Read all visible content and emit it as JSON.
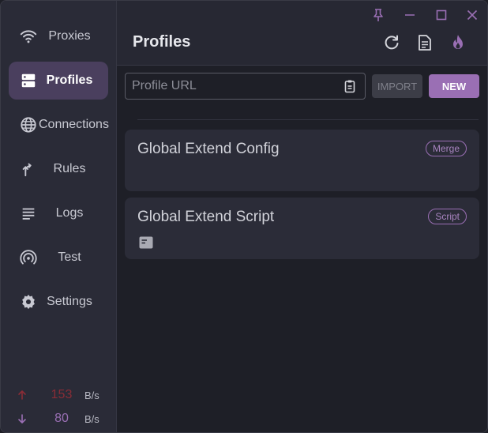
{
  "sidebar": {
    "items": [
      {
        "label": "Proxies",
        "icon": "wifi-icon",
        "active": false
      },
      {
        "label": "Profiles",
        "icon": "dns-icon",
        "active": true
      },
      {
        "label": "Connections",
        "icon": "globe-icon",
        "active": false
      },
      {
        "label": "Rules",
        "icon": "fork-icon",
        "active": false
      },
      {
        "label": "Logs",
        "icon": "list-icon",
        "active": false
      },
      {
        "label": "Test",
        "icon": "radar-icon",
        "active": false
      },
      {
        "label": "Settings",
        "icon": "gear-icon",
        "active": false
      }
    ],
    "traffic": {
      "up": {
        "value": "153",
        "unit": "B/s",
        "color": "#8a2c36"
      },
      "down": {
        "value": "80",
        "unit": "B/s",
        "color": "#9a6fb4"
      }
    }
  },
  "header": {
    "title": "Profiles",
    "buttons": [
      "refresh-icon",
      "document-icon",
      "fire-icon"
    ]
  },
  "window_controls": [
    "pin-icon",
    "minimize-icon",
    "maximize-icon",
    "close-icon"
  ],
  "import_bar": {
    "placeholder": "Profile URL",
    "value": "",
    "import_label": "IMPORT",
    "new_label": "NEW"
  },
  "profiles": [
    {
      "title": "Global Extend Config",
      "tag": "Merge",
      "has_icon": false
    },
    {
      "title": "Global Extend Script",
      "tag": "Script",
      "has_icon": true
    }
  ],
  "colors": {
    "accent": "#9a6fb4",
    "sidebar_bg": "#2a2b37",
    "main_bg": "#1e1f27",
    "card_bg": "#2b2c38"
  }
}
